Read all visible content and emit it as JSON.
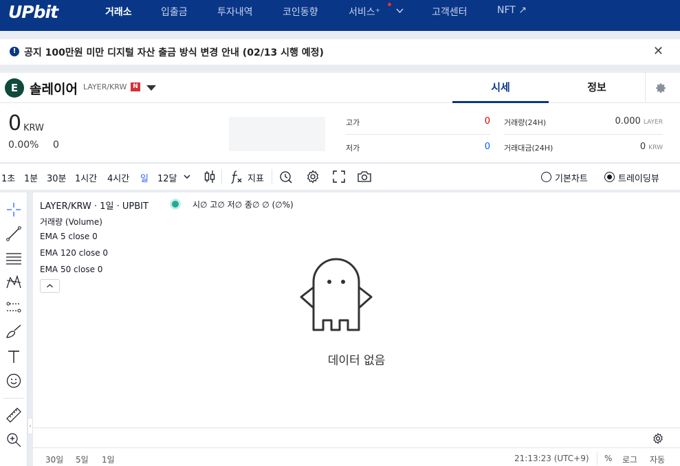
{
  "nav": {
    "logo": "UPbit",
    "items": [
      "거래소",
      "입출금",
      "투자내역",
      "코인동향",
      "서비스⁺",
      "고객센터",
      "NFT ↗"
    ],
    "active_index": 0
  },
  "notice": {
    "text": "공지 100만원 미만 디지털 자산 출금 방식 변경 안내 (02/13 시행 예정)",
    "close": "✕"
  },
  "coin": {
    "logo_letter": "E",
    "name": "솔레이어",
    "pair": "LAYER/KRW",
    "badge": "N",
    "tabs": [
      "시세",
      "정보"
    ]
  },
  "price": {
    "value": "0",
    "unit": "KRW",
    "change_pct": "0.00%",
    "change": "0",
    "high_label": "고가",
    "high_value": "0",
    "low_label": "저가",
    "low_value": "0",
    "volume_label": "거래량(24H)",
    "volume_value": "0.000",
    "volume_unit": "LAYER",
    "amount_label": "거래대금(24H)",
    "amount_value": "0",
    "amount_unit": "KRW",
    "colors": {
      "rise": "#d60000",
      "fall": "#0062df"
    }
  },
  "toolbar": {
    "intervals": [
      "1초",
      "1분",
      "30분",
      "1시간",
      "4시간",
      "일",
      "12달"
    ],
    "active_interval": "일",
    "indicators": "지표",
    "chart_types": [
      "기본차트",
      "트레이딩뷰"
    ],
    "chart_type_selected": "트레이딩뷰"
  },
  "chart": {
    "title": "LAYER/KRW · 1일 · UPBIT",
    "ohlc": "시∅ 고∅ 저∅ 종∅ ∅ (∅%)",
    "volume": "거래량 (Volume)",
    "ema": [
      "EMA 5 close 0",
      "EMA 120 close 0",
      "EMA 50 close 0"
    ],
    "no_data": "데이터 없음",
    "ranges": [
      "30일",
      "5일",
      "1일"
    ],
    "time": "21:13:23 (UTC+9)",
    "scale_options": [
      "%",
      "로그",
      "자동"
    ]
  }
}
